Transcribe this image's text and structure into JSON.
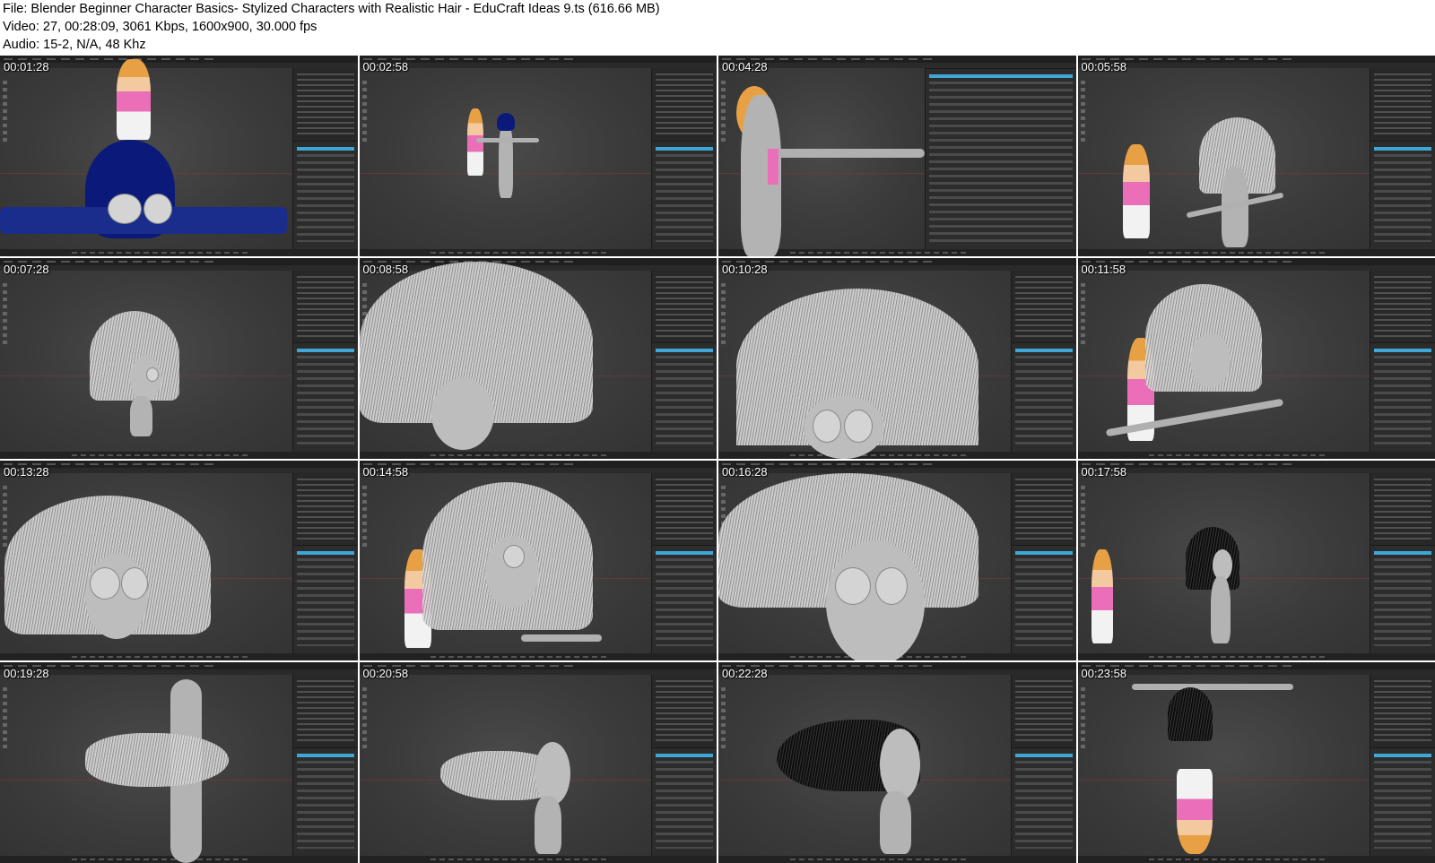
{
  "header": {
    "file_line": "File: Blender Beginner Character Basics- Stylized Characters with Realistic Hair - EduCraft Ideas 9.ts (616.66 MB)",
    "video_line": "Video: 27, 00:28:09, 3061 Kbps, 1600x900, 30.000 fps",
    "audio_line": "Audio: 15-2, N/A, 48 Khz"
  },
  "thumbnails": [
    {
      "timestamp": "00:01:28"
    },
    {
      "timestamp": "00:02:58"
    },
    {
      "timestamp": "00:04:28"
    },
    {
      "timestamp": "00:05:58"
    },
    {
      "timestamp": "00:07:28"
    },
    {
      "timestamp": "00:08:58"
    },
    {
      "timestamp": "00:10:28"
    },
    {
      "timestamp": "00:11:58"
    },
    {
      "timestamp": "00:13:28"
    },
    {
      "timestamp": "00:14:58"
    },
    {
      "timestamp": "00:16:28"
    },
    {
      "timestamp": "00:17:58"
    },
    {
      "timestamp": "00:19:28"
    },
    {
      "timestamp": "00:20:58"
    },
    {
      "timestamp": "00:22:28"
    },
    {
      "timestamp": "00:23:58"
    }
  ],
  "colors": {
    "accent_blue": "#3fa7d6",
    "viewport_gray": "#3b3b3b",
    "helmet_blue": "#0b1a7a",
    "hair_light": "#e2e2e2",
    "hair_dark": "#111111"
  }
}
